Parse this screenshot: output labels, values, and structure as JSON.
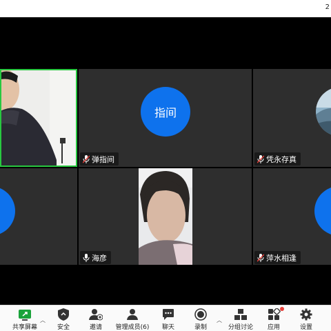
{
  "topbar": {
    "corner_text": "2"
  },
  "participants": [
    {
      "id": "video-self",
      "name": "",
      "kind": "video"
    },
    {
      "id": "tanzhijian",
      "name": "弹指间",
      "avatar_text": "指间",
      "muted": true
    },
    {
      "id": "pingyongcunzhen",
      "name": "凭永存真",
      "muted": true
    },
    {
      "id": "left-avatar",
      "name": "",
      "kind": "avatar"
    },
    {
      "id": "haiyan",
      "name": "海彦",
      "muted": false
    },
    {
      "id": "pingshuixiangfeng",
      "name": "萍水相逢",
      "muted": true
    }
  ],
  "toolbar": {
    "share": "共享屏幕",
    "security": "安全",
    "invite": "邀请",
    "participants": "管理成员(6)",
    "chat": "聊天",
    "record": "录制",
    "breakout": "分组讨论",
    "apps": "应用",
    "settings": "设置"
  },
  "colors": {
    "avatar_blue": "#0e72ed",
    "active_border": "#28c840",
    "tile_bg": "#2e2e2e",
    "share_green": "#1aa33a",
    "notify_red": "#e8403a"
  }
}
